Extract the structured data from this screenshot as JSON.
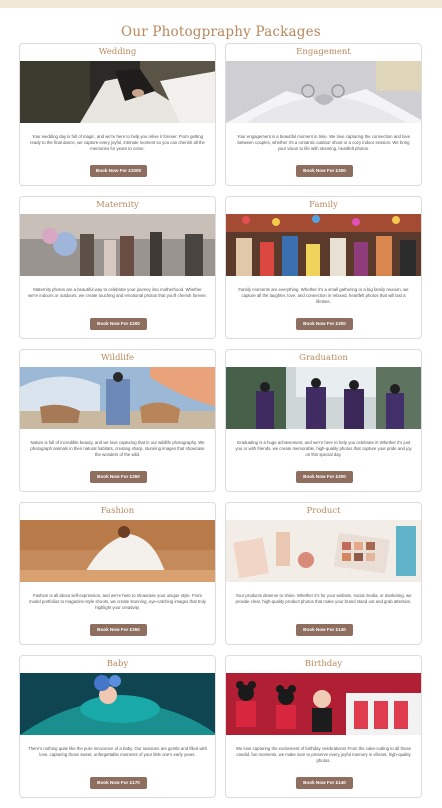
{
  "page": {
    "title": "Our Photogpraphy Packages",
    "accent_color": "#b8875a",
    "button_color": "#8d6e5f"
  },
  "packages": [
    {
      "title": "Wedding",
      "description": "Your wedding day is full of magic, and we're here to help you relive it forever. From getting ready to the final dance, we capture every joyful, intimate moment so you can cherish all the memories for years to come.",
      "button": "Book Now For £1000",
      "image": "wedding-photo"
    },
    {
      "title": "Engagement",
      "description": "Your engagement is a beautiful moment in time. We love capturing the connection and love between couples, whether it's a romantic outdoor shoot or a cozy indoor session. We bring your vision to life with stunning, heartfelt photos.",
      "button": "Book Now For £300",
      "image": "engagement-photo"
    },
    {
      "title": "Maternity",
      "description": "Maternity photos are a beautiful way to celebrate your journey into motherhood. Whether we're indoors or outdoors, we create touching and emotional photos that you'll cherish forever.",
      "button": "Book Now For £300",
      "image": "maternity-photo"
    },
    {
      "title": "Family",
      "description": "Family moments are everything. Whether it's a small gathering or a big family reunion, we capture all the laughter, love, and connection in relaxed, heartfelt photos that will last a lifetime.",
      "button": "Book Now For £300",
      "image": "family-photo"
    },
    {
      "title": "Wildlife",
      "description": "Nature is full of incredible beauty, and we love capturing that in our wildlife photography. We photograph animals in their natural habitats, creating sharp, stunning images that showcase the wonders of the wild.",
      "button": "Book Now For £350",
      "image": "wildlife-photo"
    },
    {
      "title": "Graduation",
      "description": "Graduating is a huge achievement, and we're here to help you celebrate it! Whether it's just you or with friends, we create memorable, high-quality photos that capture your pride and joy on this special day.",
      "button": "Book Now For £300",
      "image": "graduation-photo"
    },
    {
      "title": "Fashion",
      "description": "Fashion is all about self-expression, and we're here to showcase your unique style. From model portfolios to magazine-style shoots, we create stunning, eye-catching images that truly highlight your creativity.",
      "button": "Book Now For £350",
      "image": "fashion-photo"
    },
    {
      "title": "Product",
      "description": "Your products deserve to shine. Whether it's for your website, social media, or marketing, we provide clear, high-quality product photos that make your brand stand out and grab attention.",
      "button": "Book Now For £140",
      "image": "product-photo"
    },
    {
      "title": "Baby",
      "description": "There's nothing quite like the pure innocence of a baby. Our sessions are gentle and filled with love, capturing those sweet, unforgettable moments of your little one's early years.",
      "button": "Book Now For £170",
      "image": "baby-photo"
    },
    {
      "title": "Birthday",
      "description": "We love capturing the excitement of birthday celebrations! From the cake-cutting to all those candid, fun moments, we make sure to preserve every joyful memory in vibrant, high-quality photos.",
      "button": "Book Now For £140",
      "image": "birthday-photo"
    }
  ]
}
